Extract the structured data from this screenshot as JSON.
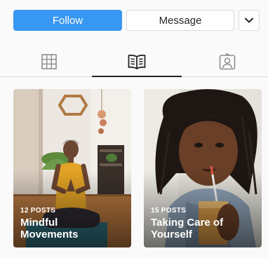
{
  "actions": {
    "follow_label": "Follow",
    "message_label": "Message",
    "more_icon": "chevron-down-icon"
  },
  "tabs": [
    {
      "name": "grid",
      "icon": "grid-icon",
      "active": false
    },
    {
      "name": "guides",
      "icon": "open-book-icon",
      "active": true
    },
    {
      "name": "tagged",
      "icon": "tagged-person-icon",
      "active": false
    }
  ],
  "guides": [
    {
      "count": "12 POSTS",
      "title": "Mindful Movements"
    },
    {
      "count": "15 POSTS",
      "title": "Taking Care of Yourself"
    }
  ],
  "colors": {
    "accent": "#3897f0",
    "text": "#262626",
    "border": "#dbdbdb",
    "background": "#fafafa"
  }
}
